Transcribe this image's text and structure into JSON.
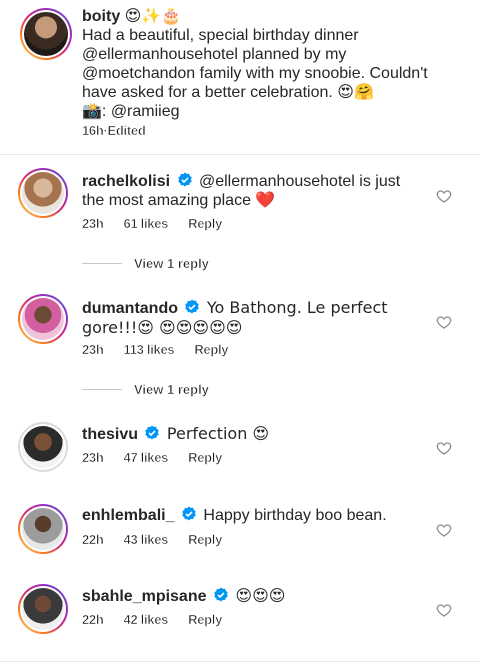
{
  "caption": {
    "username": "boity",
    "username_emojis": "😍✨🎂",
    "text": "Had a beautiful, special birthday dinner @ellermanhousehotel planned by my @moetchandon family with my snoobie. Couldn't have asked for a better celebration. 😍🤗",
    "photo_credit": "📸: @ramiieg",
    "time": "16h",
    "edited": "Edited"
  },
  "comments": [
    {
      "username": "rachelkolisi",
      "verified": true,
      "text": "@ellermanhousehotel is just the most amazing place ❤️",
      "time": "23h",
      "likes": "61 likes",
      "reply_label": "Reply",
      "view_replies": "View 1 reply"
    },
    {
      "username": "dumantando",
      "verified": true,
      "text": "Yo Bathong. Le perfect gore!!!😍 😍😍😍😍😍",
      "time": "23h",
      "likes": "113 likes",
      "reply_label": "Reply",
      "view_replies": "View 1 reply"
    },
    {
      "username": "thesivu",
      "verified": true,
      "text": "Perfection 😍",
      "time": "23h",
      "likes": "47 likes",
      "reply_label": "Reply"
    },
    {
      "username": "enhlembali_",
      "verified": true,
      "text": "Happy birthday boo bean.",
      "time": "22h",
      "likes": "43 likes",
      "reply_label": "Reply"
    },
    {
      "username": "sbahle_mpisane",
      "verified": true,
      "text": "😍😍😍",
      "time": "22h",
      "likes": "42 likes",
      "reply_label": "Reply"
    }
  ],
  "colors": {
    "verified_blue": "#0095f6",
    "story_ring": "#d62976",
    "meta_gray": "#8e8e8e"
  },
  "icons": {
    "verified": "verified-badge-icon",
    "like": "heart-outline-icon"
  }
}
